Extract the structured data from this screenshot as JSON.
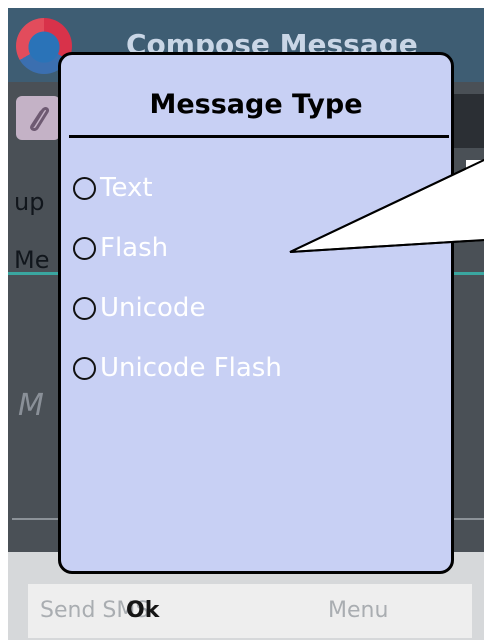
{
  "window": {
    "title": "Compose Message"
  },
  "background": {
    "field_to": "up",
    "field_msg": "Me",
    "body_hint": "M"
  },
  "dialog": {
    "title": "Message Type",
    "options": [
      {
        "label": "Text",
        "selected": false
      },
      {
        "label": "Flash",
        "selected": false
      },
      {
        "label": "Unicode",
        "selected": false
      },
      {
        "label": "Unicode Flash",
        "selected": false
      }
    ]
  },
  "softkeys": {
    "left": "Send SMS",
    "right": "Menu",
    "ok": "Ok"
  },
  "colors": {
    "dialog_bg": "#c8d0f4",
    "title_bar": "#3e5d73",
    "accent_line": "#3aa6a0"
  }
}
